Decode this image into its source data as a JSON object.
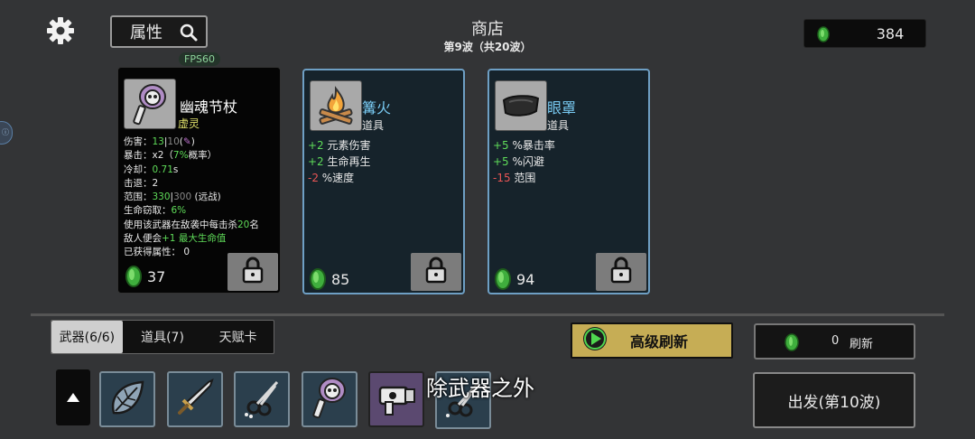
{
  "header": {
    "attr_label": "属性",
    "shop_title": "商店",
    "wave_info": "第9波（共20波）",
    "coins": "384",
    "fps": "FPS60"
  },
  "weapon_card": {
    "name": "幽魂节杖",
    "type": "虚灵",
    "stats": {
      "dmg_label": "伤害：",
      "dmg_val": "13",
      "dmg_sep": "|",
      "dmg_base": "10",
      "dmg_open": "(",
      "dmg_icon": "✎",
      "dmg_close": ")",
      "crit_label": "暴击：",
      "crit_val": "x2（",
      "crit_pct": "7%",
      "crit_rest": "概率）",
      "cd_label": "冷却：",
      "cd_val": "0.71",
      "cd_unit": "s",
      "kb": "击退：2",
      "range_label": "范围：",
      "range_val": "330",
      "range_sep": "|",
      "range_base": "300",
      "range_type": " (远战)",
      "steal_label": "生命窃取：",
      "steal_val": "6%",
      "effect_1a": "使用该武器在敌袭中每击杀",
      "effect_1b": "20",
      "effect_1c": "名",
      "effect_2a": "敌人便会",
      "effect_2b": "+1 最大生命值",
      "gained": "已获得属性： 0"
    },
    "price": "37"
  },
  "item_cards": [
    {
      "name": "篝火",
      "type": "道具",
      "lines": [
        {
          "sign": "+2",
          "sign_color": "green",
          "text": " 元素伤害"
        },
        {
          "sign": "+2",
          "sign_color": "green",
          "text": " 生命再生"
        },
        {
          "sign": "-2",
          "sign_color": "red",
          "text": " %速度"
        }
      ],
      "price": "85"
    },
    {
      "name": "眼罩",
      "type": "道具",
      "lines": [
        {
          "sign": "+5",
          "sign_color": "green",
          "text": " %暴击率"
        },
        {
          "sign": "+5",
          "sign_color": "green",
          "text": " %闪避"
        },
        {
          "sign": "-15",
          "sign_color": "red",
          "text": " 范围"
        }
      ],
      "price": "94"
    }
  ],
  "tabs": [
    "武器(6/6)",
    "道具(7)",
    "天赋卡"
  ],
  "advanced_refresh": "高级刷新",
  "refresh": {
    "cost": "0",
    "label": "刷新"
  },
  "subtitle": "除武器之外",
  "go_button": "出发(第10波)",
  "colors": {
    "accent_green": "#5fdc59",
    "negative_red": "#e85555",
    "item_border": "#6e9fc4",
    "gold_button": "#c6ad55"
  },
  "inventory_icons": [
    "leaf-shield-icon",
    "sword-icon",
    "scissors-icon",
    "skull-staff-icon",
    "blaster-icon",
    "scissors-icon"
  ]
}
